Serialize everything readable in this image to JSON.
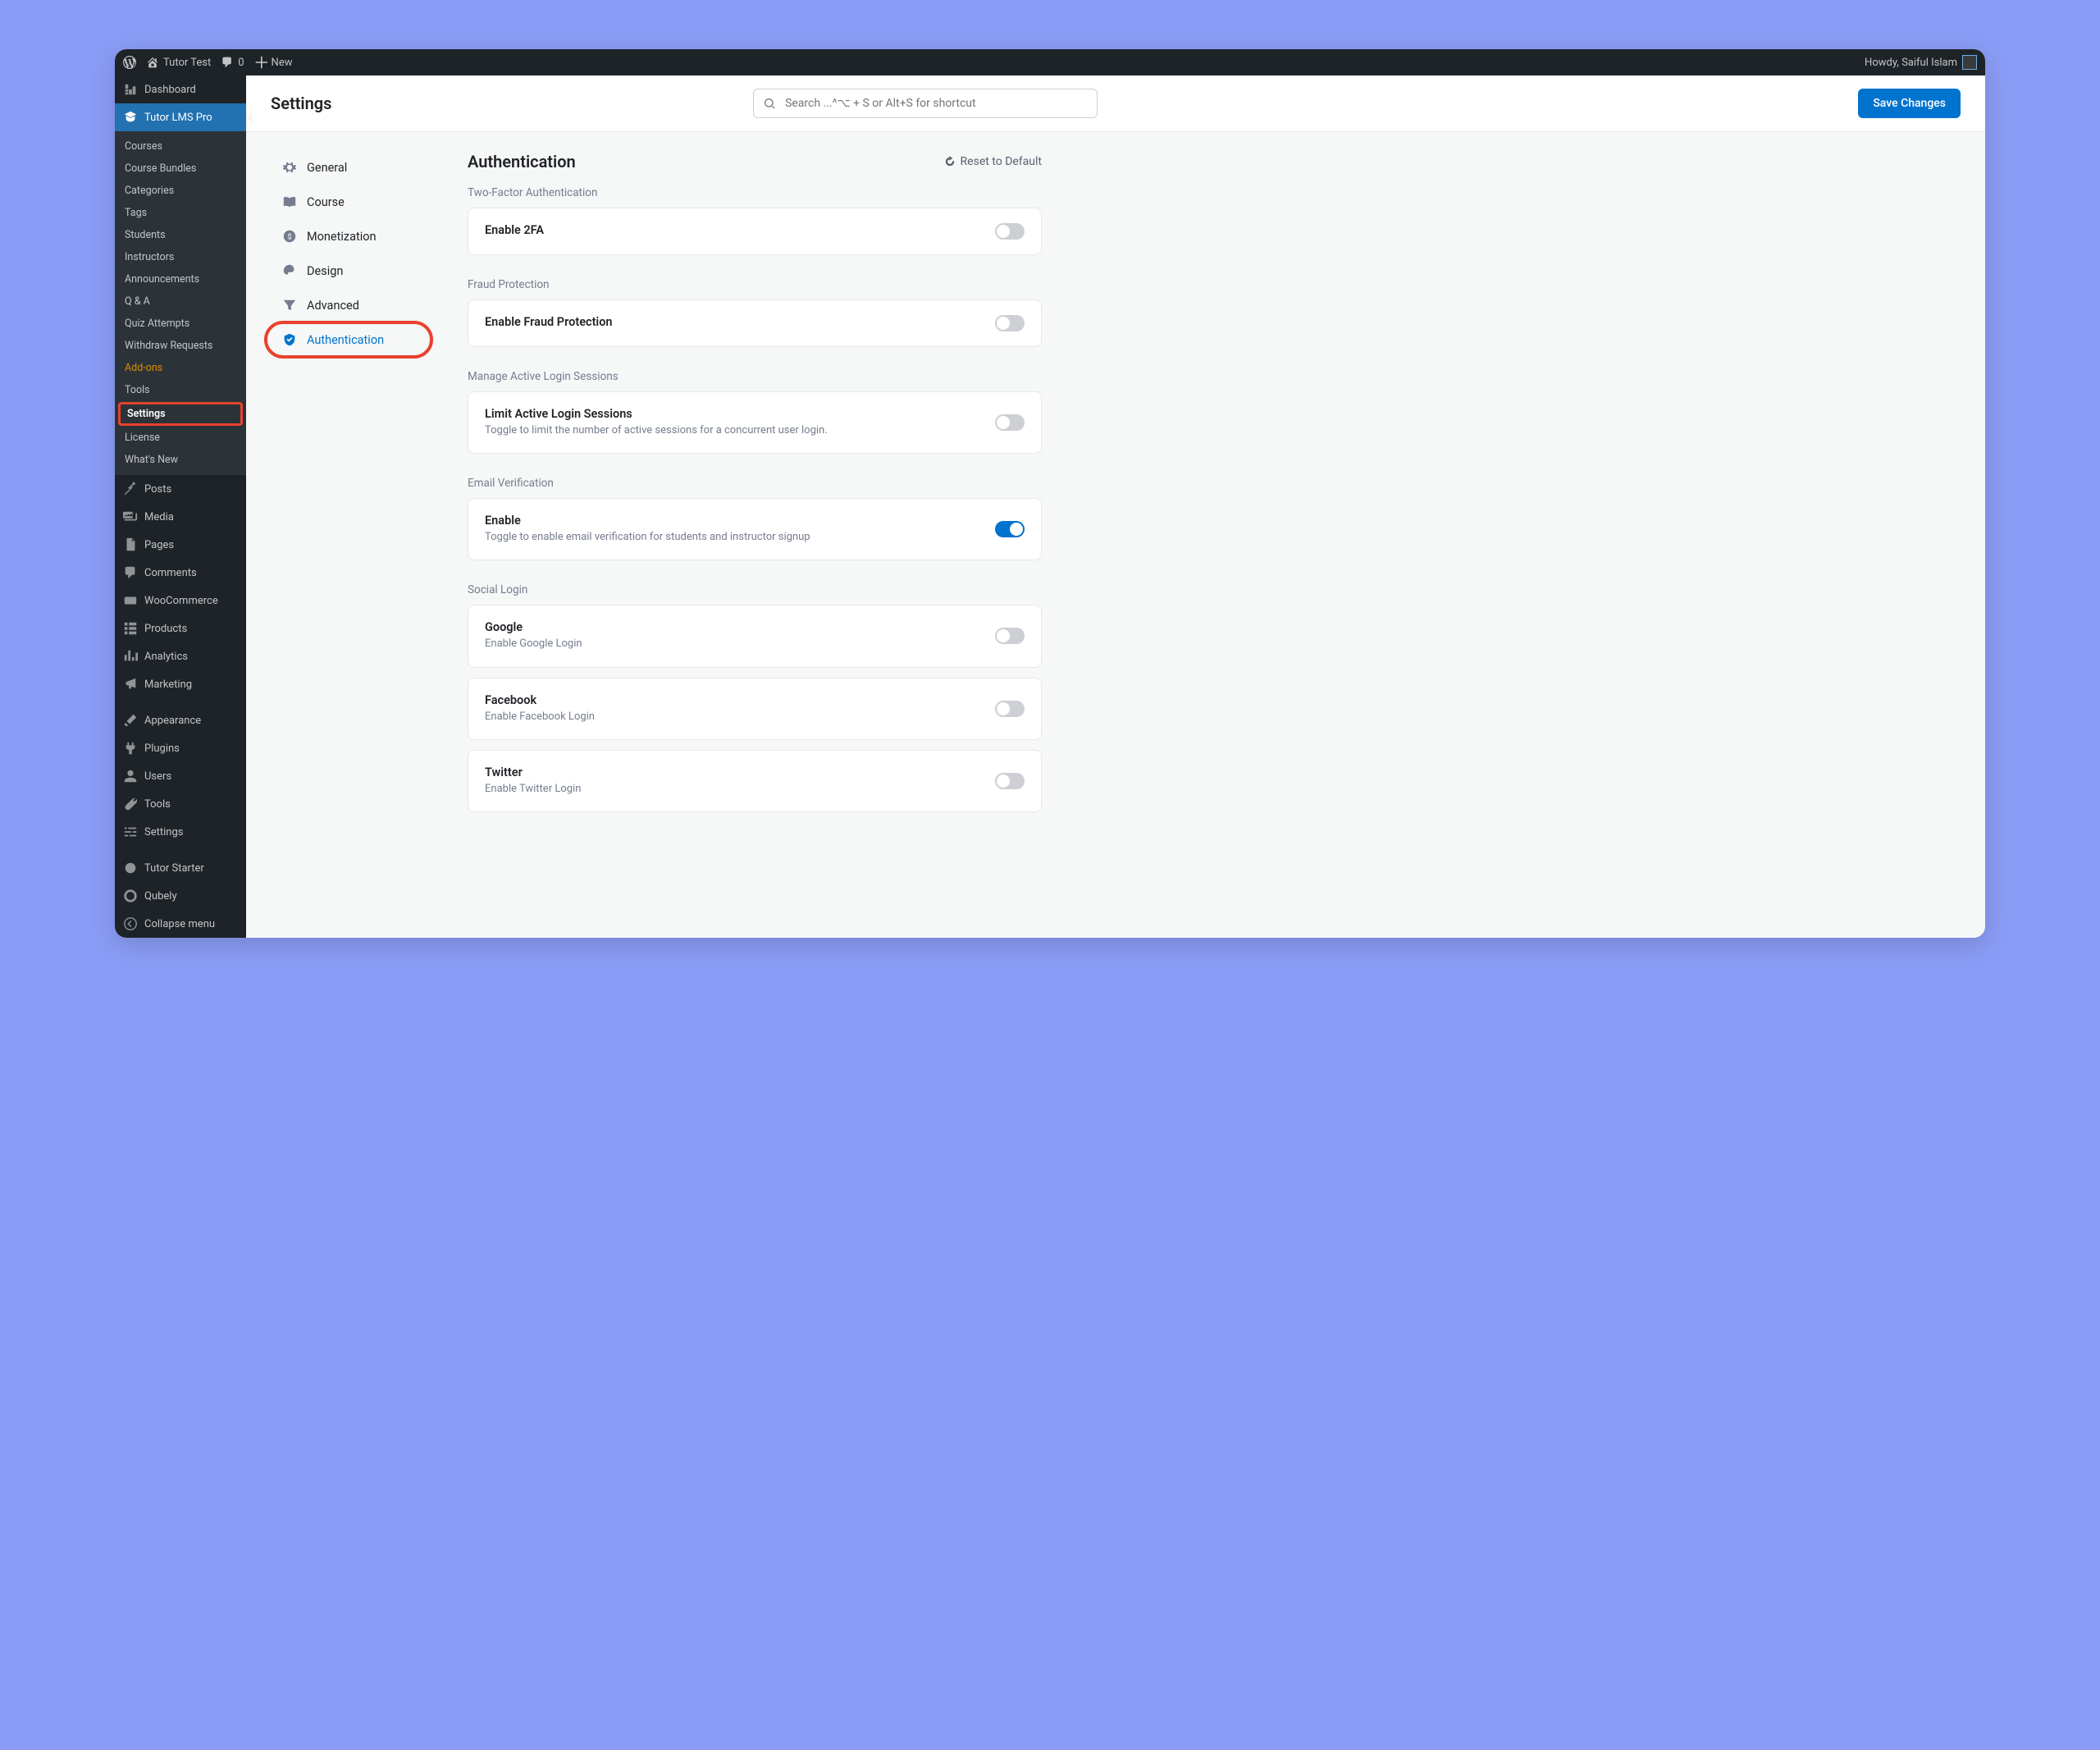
{
  "adminbar": {
    "site_name": "Tutor Test",
    "comment_count": "0",
    "new_label": "New",
    "greeting": "Howdy, Saiful Islam"
  },
  "sidebar": {
    "dashboard": "Dashboard",
    "tutor_lms": "Tutor LMS Pro",
    "submenu": {
      "courses": "Courses",
      "bundles": "Course Bundles",
      "categories": "Categories",
      "tags": "Tags",
      "students": "Students",
      "instructors": "Instructors",
      "announcements": "Announcements",
      "qa": "Q & A",
      "quiz_attempts": "Quiz Attempts",
      "withdraw": "Withdraw Requests",
      "addons": "Add-ons",
      "tools": "Tools",
      "settings": "Settings",
      "license": "License",
      "whats_new": "What's New"
    },
    "posts": "Posts",
    "media": "Media",
    "pages": "Pages",
    "comments": "Comments",
    "woocommerce": "WooCommerce",
    "products": "Products",
    "analytics": "Analytics",
    "marketing": "Marketing",
    "appearance": "Appearance",
    "plugins": "Plugins",
    "users": "Users",
    "wp_tools": "Tools",
    "wp_settings": "Settings",
    "tutor_starter": "Tutor Starter",
    "qubely": "Qubely",
    "collapse": "Collapse menu"
  },
  "header": {
    "title": "Settings",
    "search_placeholder": "Search ...^⌥ + S or Alt+S for shortcut",
    "save_button": "Save Changes"
  },
  "tabs": {
    "general": "General",
    "course": "Course",
    "monetization": "Monetization",
    "design": "Design",
    "advanced": "Advanced",
    "authentication": "Authentication"
  },
  "panel": {
    "title": "Authentication",
    "reset_label": "Reset to Default",
    "sections": {
      "two_factor": {
        "label": "Two-Factor Authentication",
        "item_title": "Enable 2FA"
      },
      "fraud": {
        "label": "Fraud Protection",
        "item_title": "Enable Fraud Protection"
      },
      "sessions": {
        "label": "Manage Active Login Sessions",
        "item_title": "Limit Active Login Sessions",
        "item_desc": "Toggle to limit the number of active sessions for a concurrent user login."
      },
      "email": {
        "label": "Email Verification",
        "item_title": "Enable",
        "item_desc": "Toggle to enable email verification for students and instructor signup"
      },
      "social": {
        "label": "Social Login",
        "google_title": "Google",
        "google_desc": "Enable Google Login",
        "facebook_title": "Facebook",
        "facebook_desc": "Enable Facebook Login",
        "twitter_title": "Twitter",
        "twitter_desc": "Enable Twitter Login"
      }
    }
  }
}
